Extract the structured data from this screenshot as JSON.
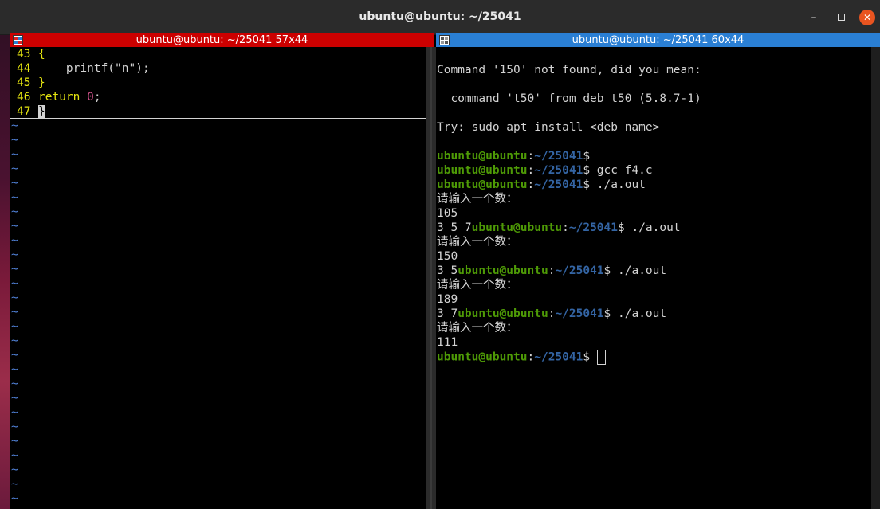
{
  "window": {
    "title": "ubuntu@ubuntu: ~/25041",
    "minimize": "–",
    "close": "✕"
  },
  "left_pane": {
    "header": "ubuntu@ubuntu: ~/25041 57x44",
    "code": [
      {
        "num": "43",
        "text": "{"
      },
      {
        "num": "44",
        "text": "    printf(\"n\");"
      },
      {
        "num": "45",
        "text": "}"
      },
      {
        "num": "46",
        "kw": "return",
        "num_lit": "0",
        "end": ";"
      },
      {
        "num": "47",
        "text": "}"
      }
    ],
    "tilde": "~"
  },
  "right_pane": {
    "header": "ubuntu@ubuntu: ~/25041 60x44",
    "prompt_user": "ubuntu@ubuntu",
    "prompt_path": "~/25041",
    "lines": {
      "l1": "Command '150' not found, did you mean:",
      "l2": "  command 't50' from deb t50 (5.8.7-1)",
      "l3": "Try: sudo apt install <deb name>",
      "cmd_empty": "",
      "cmd_gcc": " gcc f4.c",
      "cmd_run": " ./a.out",
      "ask": "请输入一个数：",
      "in1": "105",
      "out1": "3 5 7",
      "in2": "150",
      "out2": "3 5",
      "in3": "189",
      "out3": "3 7",
      "in4": "111"
    }
  },
  "colors": {
    "left_header": "#cc0000",
    "right_header": "#2a7fd4",
    "prompt_user": "#4e9a06",
    "prompt_path": "#3465a4",
    "line_number": "#e5e510",
    "tilde": "#4f7fd4"
  },
  "icons": {
    "close": "close-icon",
    "minimize": "minimize-icon",
    "maximize": "maximize-icon",
    "pane": "terminator-grid-icon"
  }
}
